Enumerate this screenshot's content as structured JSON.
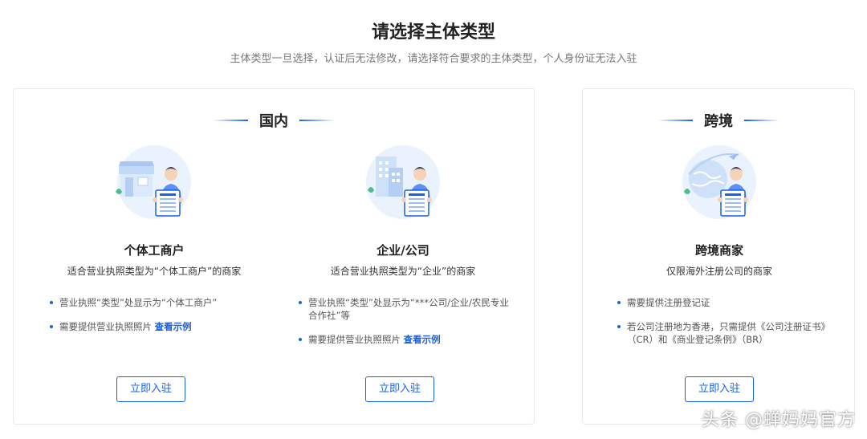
{
  "page": {
    "title": "请选择主体类型",
    "subtitle": "主体类型一旦选择，认证后无法修改，请选择符合要求的主体类型，个人身份证无法入驻"
  },
  "domestic": {
    "heading": "国内",
    "cards": [
      {
        "title": "个体工商户",
        "desc": "适合营业执照类型为“个体工商户”的商家",
        "bullets": [
          "营业执照“类型”处显示为“个体工商户”",
          "需要提供营业执照照片"
        ],
        "example_link": "查看示例",
        "button": "立即入驻"
      },
      {
        "title": "企业/公司",
        "desc": "适合营业执照类型为“企业”的商家",
        "bullets": [
          "营业执照“类型”处显示为“***公司/企业/农民专业合作社”等",
          "需要提供营业执照照片"
        ],
        "example_link": "查看示例",
        "button": "立即入驻"
      }
    ]
  },
  "cross_border": {
    "heading": "跨境",
    "card": {
      "title": "跨境商家",
      "desc": "仅限海外注册公司的商家",
      "bullets": [
        "需要提供注册登记证",
        "若公司注册地为香港，只需提供《公司注册证书》（CR）和《商业登记条例》（BR）"
      ],
      "button": "立即入驻"
    }
  },
  "watermark": "头条 @蝉妈妈官方",
  "colors": {
    "accent": "#1761e6",
    "illus_bg": "#eaf2fd",
    "panel_border": "#e6e8eb"
  },
  "icons": [
    "shop-person-illustration",
    "building-person-illustration",
    "globe-person-illustration"
  ]
}
